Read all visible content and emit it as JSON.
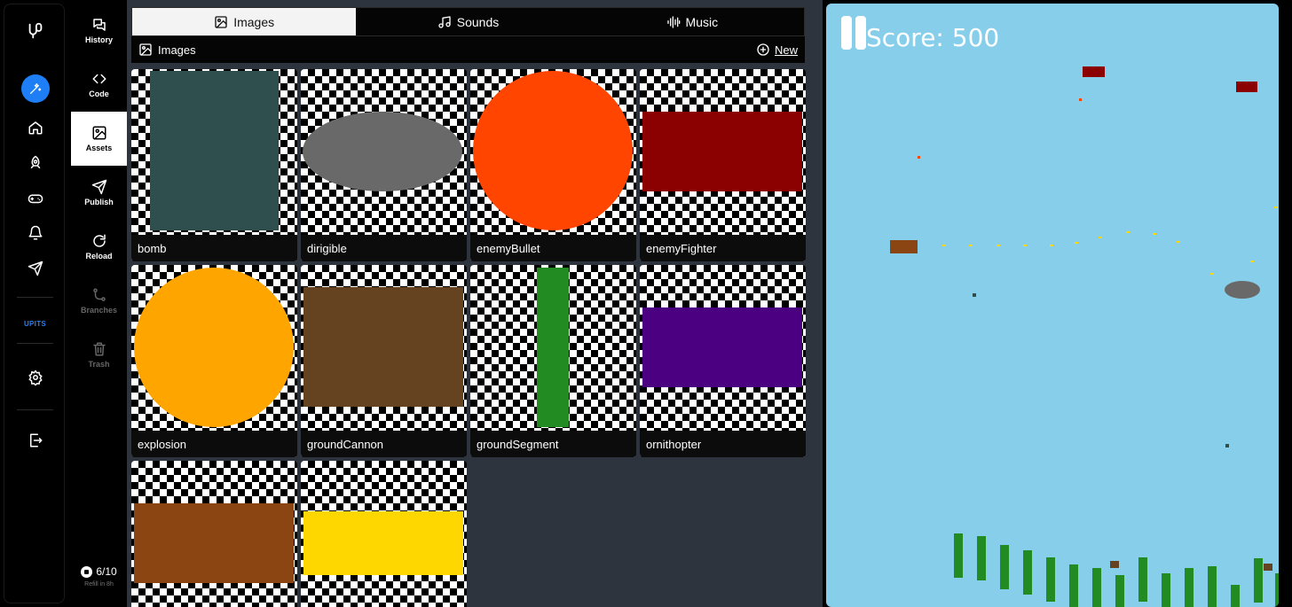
{
  "rail": {
    "logo_icon": "logo-icon",
    "items": [
      "magic-wand-icon",
      "home-icon",
      "rocket-icon",
      "gamepad-icon",
      "bell-icon",
      "send-icon"
    ],
    "upits_label": "UPITS",
    "settings_icon": "gear-icon",
    "exit_icon": "exit-icon",
    "accent": "#1e7ef5"
  },
  "nav": {
    "items": [
      {
        "label": "History",
        "icon": "history-icon",
        "active": false
      },
      {
        "label": "Code",
        "icon": "code-icon",
        "active": false
      },
      {
        "label": "Assets",
        "icon": "image-icon",
        "active": true
      },
      {
        "label": "Publish",
        "icon": "send-icon",
        "active": false
      },
      {
        "label": "Reload",
        "icon": "reload-icon",
        "active": false
      },
      {
        "label": "Branches",
        "icon": "branch-icon",
        "active": false,
        "disabled": true
      },
      {
        "label": "Trash",
        "icon": "trash-icon",
        "active": false,
        "disabled": true
      }
    ],
    "credits": "6/10",
    "refill": "Refill in 8h"
  },
  "assets": {
    "tabs": [
      {
        "label": "Images",
        "icon": "image-icon",
        "active": true
      },
      {
        "label": "Sounds",
        "icon": "music-note-icon",
        "active": false
      },
      {
        "label": "Music",
        "icon": "waveform-icon",
        "active": false
      }
    ],
    "section_label": "Images",
    "new_label": "New",
    "images": [
      {
        "name": "bomb",
        "color": "#2f4f4f",
        "shape": "rect"
      },
      {
        "name": "dirigible",
        "color": "#696969",
        "shape": "ellipse"
      },
      {
        "name": "enemyBullet",
        "color": "#ff4500",
        "shape": "circle"
      },
      {
        "name": "enemyFighter",
        "color": "#8b0000",
        "shape": "rect"
      },
      {
        "name": "explosion",
        "color": "#ffa500",
        "shape": "circle"
      },
      {
        "name": "groundCannon",
        "color": "#654321",
        "shape": "rect"
      },
      {
        "name": "groundSegment",
        "color": "#228b22",
        "shape": "rect"
      },
      {
        "name": "ornithopter",
        "color": "#4b0082",
        "shape": "rect"
      },
      {
        "name": "",
        "color": "#8b4513",
        "shape": "rect"
      },
      {
        "name": "",
        "color": "#ffd700",
        "shape": "rect"
      }
    ]
  },
  "game": {
    "score_text": "Score: 500",
    "sky_color": "#87ceeb"
  }
}
